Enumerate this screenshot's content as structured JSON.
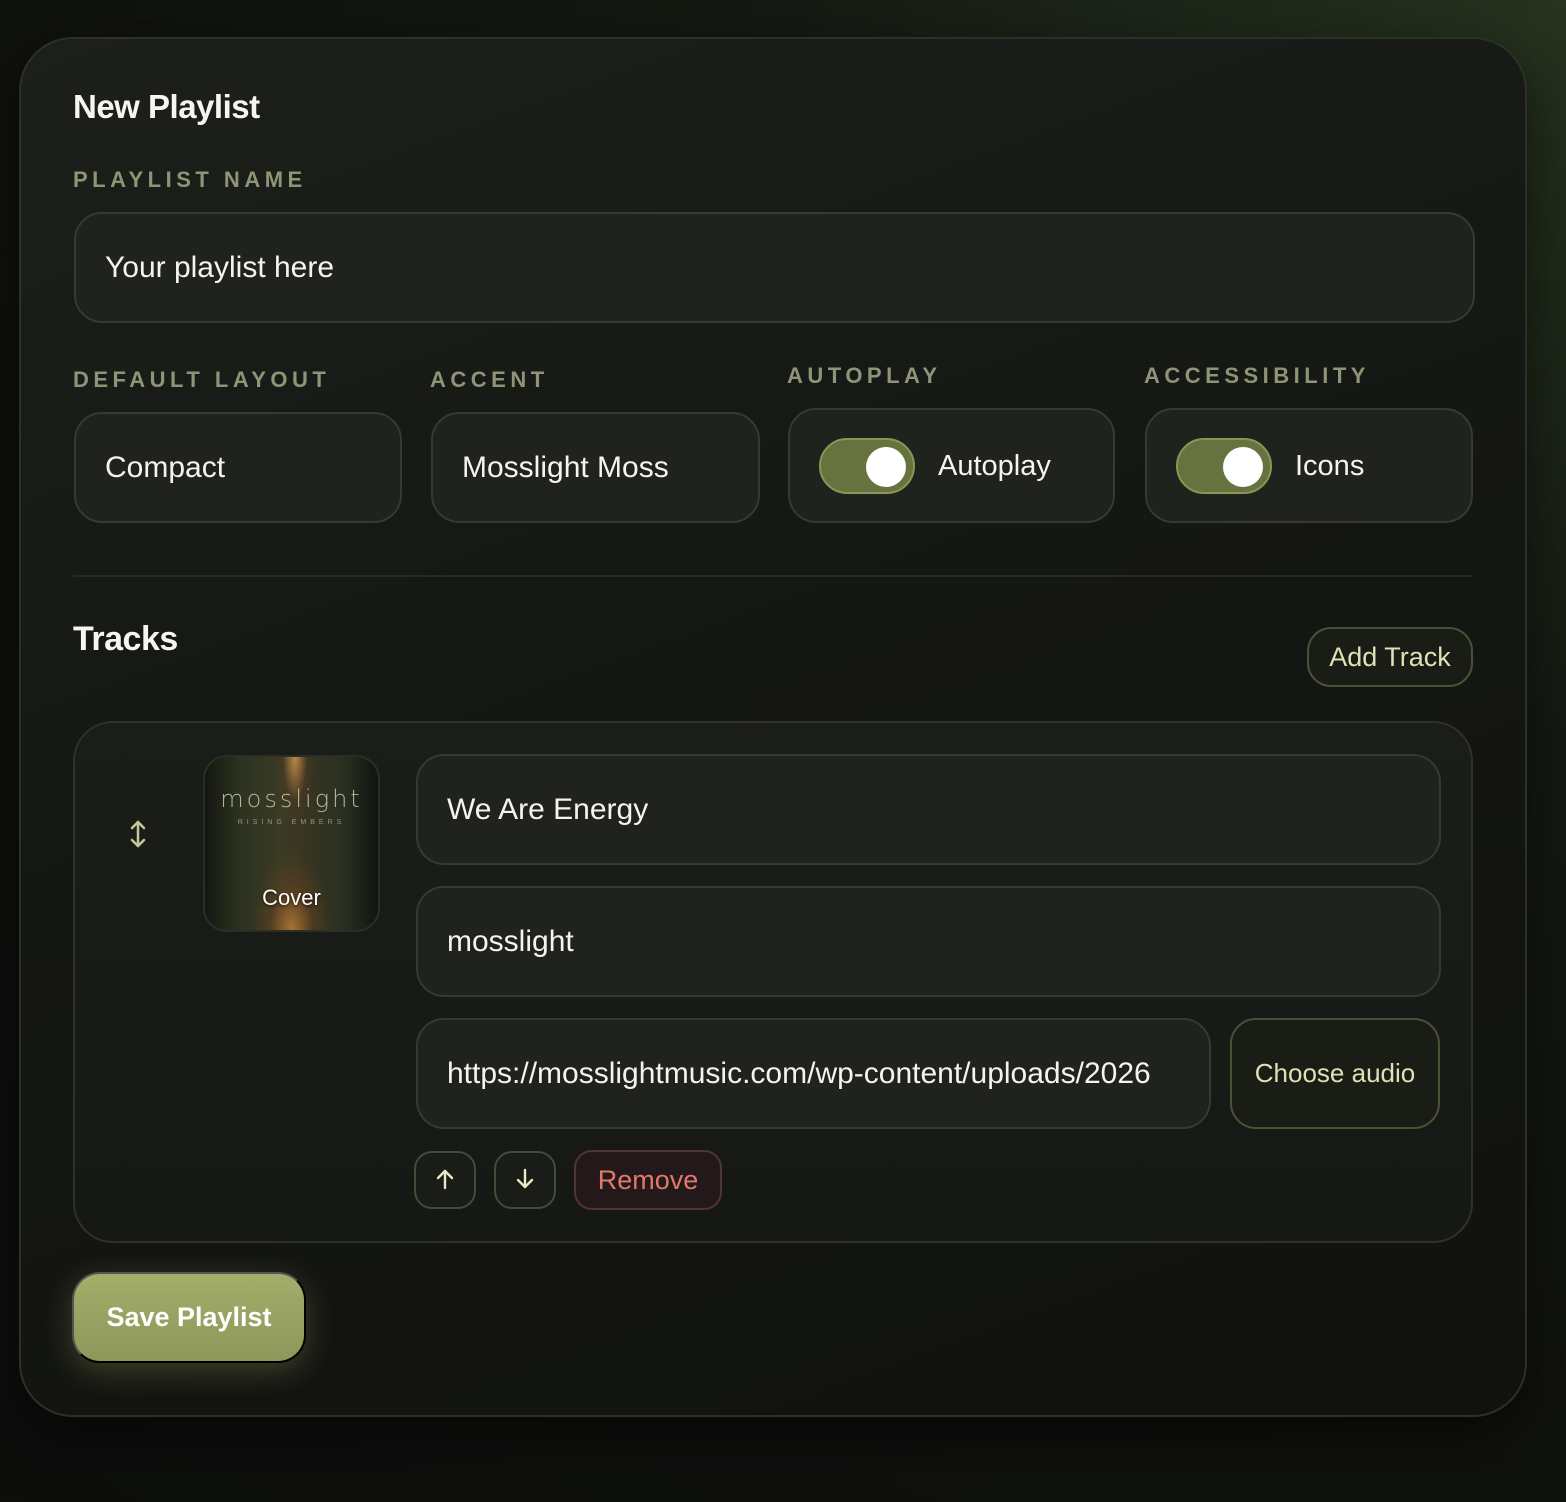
{
  "form": {
    "title": "New Playlist",
    "playlist_name_label": "PLAYLIST NAME",
    "playlist_name_value": "Your playlist here",
    "default_layout_label": "DEFAULT LAYOUT",
    "default_layout_value": "Compact",
    "accent_label": "ACCENT",
    "accent_value": "Mosslight Moss",
    "autoplay_label": "AUTOPLAY",
    "autoplay_toggle_text": "Autoplay",
    "autoplay_on": true,
    "accessibility_label": "ACCESSIBILITY",
    "accessibility_toggle_text": "Icons",
    "accessibility_on": true
  },
  "tracks": {
    "title": "Tracks",
    "add_track_label": "Add Track",
    "items": [
      {
        "cover_brand": "mosslight",
        "cover_subtitle": "RISING EMBERS",
        "cover_label": "Cover",
        "title": "We Are Energy",
        "artist": "mosslight",
        "audio_url": "https://mosslightmusic.com/wp-content/uploads/2026",
        "choose_audio_label": "Choose audio",
        "remove_label": "Remove"
      }
    ]
  },
  "save_label": "Save Playlist",
  "icons": {
    "drag": "drag-handle-icon",
    "move_up": "arrow-up-icon",
    "move_down": "arrow-down-icon"
  },
  "colors": {
    "accent": "#8c975a",
    "toggle_on": "#67733f",
    "danger": "#e1786a",
    "label": "#8e9476"
  }
}
